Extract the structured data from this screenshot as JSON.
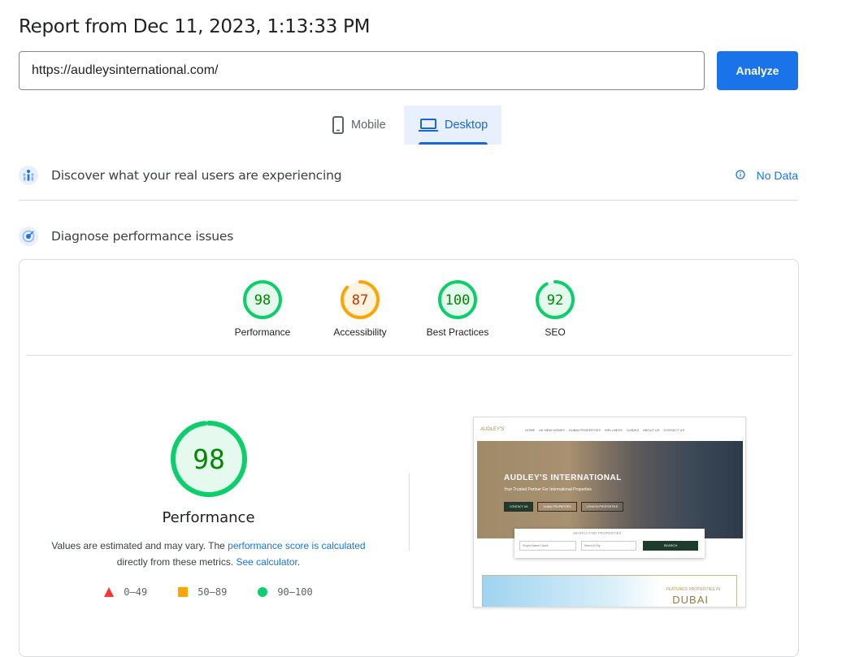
{
  "report": {
    "title": "Report from Dec 11, 2023, 1:13:33 PM"
  },
  "url_input": {
    "value": "https://audleysinternational.com/"
  },
  "analyze_button": {
    "label": "Analyze"
  },
  "device_tabs": {
    "mobile": "Mobile",
    "desktop": "Desktop",
    "selected": "Desktop"
  },
  "field_data": {
    "title": "Discover what your real users are experiencing",
    "status": "No Data"
  },
  "lab_data": {
    "title": "Diagnose performance issues"
  },
  "scores": [
    {
      "label": "Performance",
      "value": "98",
      "color": "#0cce6b",
      "text_color": "#008800",
      "fraction": 0.98
    },
    {
      "label": "Accessibility",
      "value": "87",
      "color": "#ffa400",
      "text_color": "#c33300",
      "fraction": 0.87
    },
    {
      "label": "Best Practices",
      "value": "100",
      "color": "#0cce6b",
      "text_color": "#008800",
      "fraction": 1.0
    },
    {
      "label": "SEO",
      "value": "92",
      "color": "#0cce6b",
      "text_color": "#008800",
      "fraction": 0.92
    }
  ],
  "performance": {
    "score": "98",
    "fraction": 0.98,
    "title": "Performance",
    "desc_1": "Values are estimated and may vary. The ",
    "link_1": "performance score is calculated",
    "desc_2": "directly from these metrics. ",
    "link_2": "See calculator",
    "desc_3": "."
  },
  "legend": [
    {
      "shape": "triangle",
      "color": "#ff3333",
      "label": "0–49"
    },
    {
      "shape": "square",
      "color": "#ffa400",
      "label": "50–89"
    },
    {
      "shape": "circle",
      "color": "#0cce6b",
      "label": "90–100"
    }
  ],
  "screenshot": {
    "logo": "AUDLEY'S",
    "nav_items": [
      "HOME",
      "UK NEW HOMES",
      "DUBAI PROPERTIES",
      "WELLNESS",
      "GUIDES",
      "ABOUT US",
      "CONTACT US"
    ],
    "hero_title": "AUDLEY'S INTERNATIONAL",
    "hero_subtitle": "Your Trusted Partner For International Properties",
    "hero_buttons": [
      "CONTACT US",
      "DUBAI PROPERTIES",
      "LONDON PROPERTIES"
    ],
    "search_title": "SEARCH FOR PROPERTIES",
    "search_field_1": "Project Name / Area",
    "search_field_2": "Select a City",
    "search_button": "SEARCH",
    "featured_text": "FEATURED PROPERTIES IN",
    "featured_city": "DUBAI"
  }
}
